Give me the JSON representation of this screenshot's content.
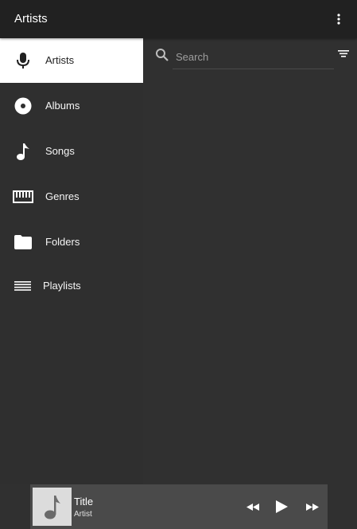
{
  "toolbar": {
    "title": "Artists",
    "overflow_icon": "more-vertical-icon"
  },
  "sidebar": {
    "items": [
      {
        "label": "Artists",
        "icon": "microphone-icon",
        "active": true
      },
      {
        "label": "Albums",
        "icon": "album-disc-icon",
        "active": false
      },
      {
        "label": "Songs",
        "icon": "music-note-icon",
        "active": false
      },
      {
        "label": "Genres",
        "icon": "piano-keys-icon",
        "active": false
      },
      {
        "label": "Folders",
        "icon": "folder-icon",
        "active": false
      },
      {
        "label": "Playlists",
        "icon": "playlist-icon",
        "active": false
      }
    ]
  },
  "search": {
    "placeholder": "Search",
    "value": ""
  },
  "player": {
    "title": "Title",
    "artist": "Artist"
  },
  "colors": {
    "toolbar_bg": "#212121",
    "content_bg": "#303030",
    "active_item_bg": "#ffffff",
    "player_bg": "#4a4a4a",
    "album_art_bg": "#dcdcdc"
  }
}
